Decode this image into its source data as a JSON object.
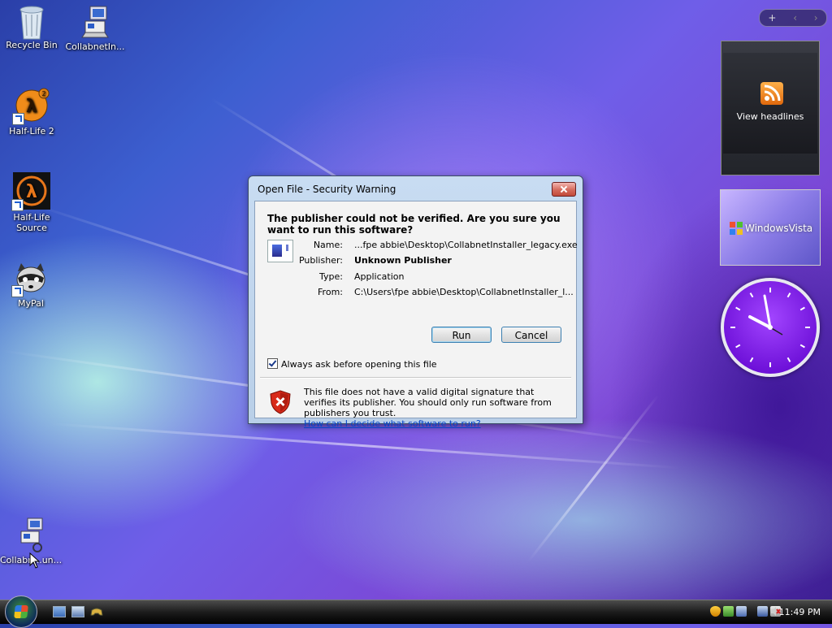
{
  "desktop": {
    "icons": [
      {
        "label": "Recycle Bin"
      },
      {
        "label": "CollabnetIn..."
      },
      {
        "label": "Half-Life 2"
      },
      {
        "label": "Half-Life Source"
      },
      {
        "label": "MyPal"
      },
      {
        "label": "Collabn...un..."
      }
    ]
  },
  "sidebar": {
    "add_label": "+",
    "prev_label": "‹",
    "next_label": "›",
    "feed_label": "View headlines",
    "slideshow_text": "WindowsVista"
  },
  "dialog": {
    "title": "Open File - Security Warning",
    "heading": "The publisher could not be verified.  Are you sure you want to run this software?",
    "fields": [
      {
        "label": "Name:",
        "value": "...fpe abbie\\Desktop\\CollabnetInstaller_legacy.exe"
      },
      {
        "label": "Publisher:",
        "value": "Unknown Publisher"
      },
      {
        "label": "Type:",
        "value": "Application"
      },
      {
        "label": "From:",
        "value": "C:\\Users\\fpe abbie\\Desktop\\CollabnetInstaller_l..."
      }
    ],
    "run_label": "Run",
    "cancel_label": "Cancel",
    "checkbox_label": "Always ask before opening this file",
    "checkbox_checked": true,
    "warning_text": "This file does not have a valid digital signature that verifies its publisher.  You should only run software from publishers you trust.",
    "warning_link": "How can I decide what software to run?"
  },
  "taskbar": {
    "time": "11:49 PM"
  }
}
